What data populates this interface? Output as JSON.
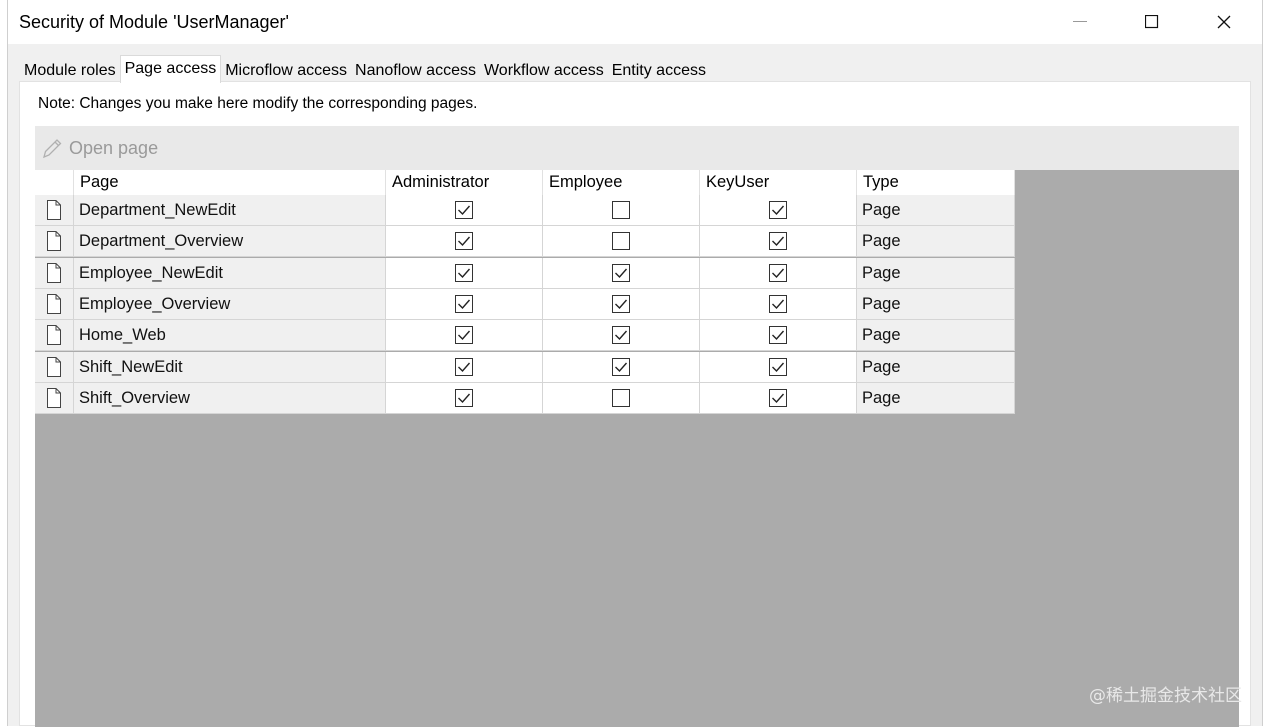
{
  "window": {
    "title": "Security of Module 'UserManager'"
  },
  "tabs": [
    {
      "label": "Module roles",
      "active": false
    },
    {
      "label": "Page access",
      "active": true
    },
    {
      "label": "Microflow access",
      "active": false
    },
    {
      "label": "Nanoflow access",
      "active": false
    },
    {
      "label": "Workflow access",
      "active": false
    },
    {
      "label": "Entity access",
      "active": false
    }
  ],
  "note": "Note: Changes you make here modify the corresponding pages.",
  "toolbar": {
    "open_page_label": "Open page",
    "open_page_icon": "pencil-icon"
  },
  "table": {
    "columns": [
      "Page",
      "Administrator",
      "Employee",
      "KeyUser",
      "Type"
    ],
    "rows": [
      {
        "page": "Department_NewEdit",
        "administrator": true,
        "employee": false,
        "keyuser": true,
        "type": "Page"
      },
      {
        "page": "Department_Overview",
        "administrator": true,
        "employee": false,
        "keyuser": true,
        "type": "Page"
      },
      {
        "page": "Employee_NewEdit",
        "administrator": true,
        "employee": true,
        "keyuser": true,
        "type": "Page"
      },
      {
        "page": "Employee_Overview",
        "administrator": true,
        "employee": true,
        "keyuser": true,
        "type": "Page"
      },
      {
        "page": "Home_Web",
        "administrator": true,
        "employee": true,
        "keyuser": true,
        "type": "Page"
      },
      {
        "page": "Shift_NewEdit",
        "administrator": true,
        "employee": true,
        "keyuser": true,
        "type": "Page"
      },
      {
        "page": "Shift_Overview",
        "administrator": true,
        "employee": false,
        "keyuser": true,
        "type": "Page"
      }
    ]
  },
  "watermark": "@稀土掘金技术社区"
}
